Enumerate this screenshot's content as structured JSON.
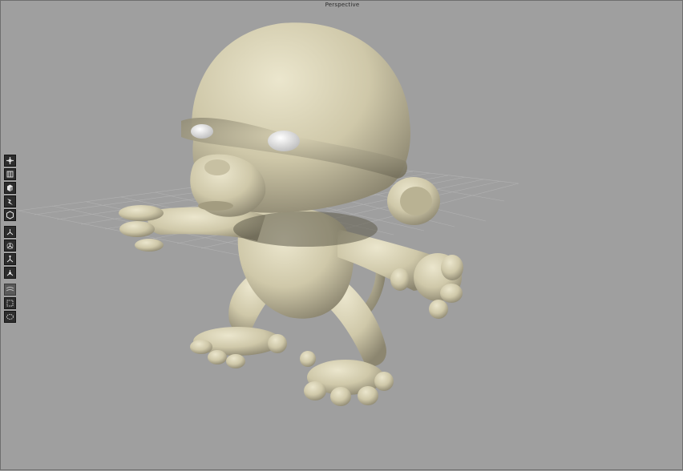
{
  "viewport": {
    "title": "Perspective",
    "background": "#9f9f9f",
    "model_color": "#d7d1b4"
  },
  "toolbar": {
    "tools": [
      {
        "icon": "move-view-icon"
      },
      {
        "icon": "texture-view-icon"
      },
      {
        "icon": "shaded-cube-icon"
      },
      {
        "icon": "lighting-icon"
      },
      {
        "icon": "wireframe-hexagon-icon"
      },
      {
        "icon": "axis-view-icon"
      },
      {
        "icon": "axis-rotate-icon"
      },
      {
        "icon": "axis-scale-icon"
      },
      {
        "icon": "axis-world-icon"
      },
      {
        "icon": "grid-toggle-icon"
      },
      {
        "icon": "frame-select-icon"
      },
      {
        "icon": "frame-all-icon"
      }
    ]
  }
}
